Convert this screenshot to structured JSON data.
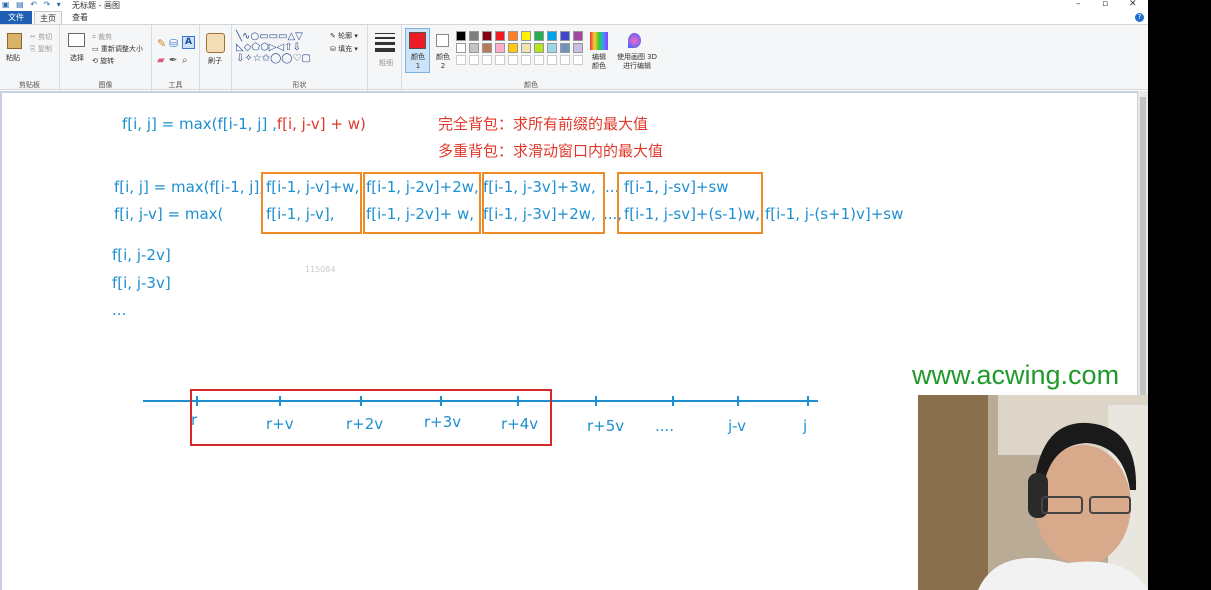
{
  "window": {
    "title": "无标题 - 画图",
    "controls": [
      "–",
      "▫",
      "✕"
    ]
  },
  "menu": {
    "file": "文件",
    "tabs": [
      "主页",
      "查看"
    ]
  },
  "ribbon": {
    "clipboard": {
      "paste": "粘贴",
      "cut": "剪切",
      "copy": "复制",
      "label": "剪贴板"
    },
    "image": {
      "select": "选择",
      "crop": "裁剪",
      "resize": "重新调整大小",
      "rotate": "旋转",
      "label": "图像"
    },
    "tools": {
      "label": "工具",
      "text": "A"
    },
    "brushes": {
      "label": "刷子"
    },
    "shapes": {
      "outline": "轮廓",
      "fill": "填充",
      "label": "形状"
    },
    "size": {
      "label": "粗细"
    },
    "colors": {
      "color1": "颜色 1",
      "color2": "颜色 2",
      "edit": "编辑颜色",
      "paint3d": "使用画图 3D 进行编辑",
      "label": "颜色",
      "palette": [
        "#000000",
        "#7f7f7f",
        "#880015",
        "#ed1c24",
        "#ff7f27",
        "#fff200",
        "#22b14c",
        "#00a2e8",
        "#3f48cc",
        "#a349a4",
        "#ffffff",
        "#c3c3c3",
        "#b97a57",
        "#ffaec9",
        "#ffc90e",
        "#efe4b0",
        "#b5e61d",
        "#99d9ea",
        "#7092be",
        "#c8bfe7"
      ],
      "active": "#ed1c24"
    }
  },
  "canvas": {
    "line1_blue": "f[i, j] = max(f[i-1, j] ,",
    "line1_red": "f[i, j-v] + w)",
    "note1": "完全背包：求所有前缀的最大值",
    "note2": "多重背包：求滑动窗口内的最大值",
    "row1_prefix": "f[i, j] = max(f[i-1, j],",
    "row1_t1": "f[i-1, j-v]+w,",
    "row1_t2": "f[i-1, j-2v]+2w,",
    "row1_t3": "f[i-1, j-3v]+3w,",
    "row1_dots": "...",
    "row1_t4": "f[i-1, j-sv]+sw",
    "row2_prefix": "f[i, j-v] = max(",
    "row2_t1": "f[i-1, j-v],",
    "row2_t2": "f[i-1, j-2v]+  w,",
    "row2_t3": "f[i-1, j-3v]+2w,",
    "row2_dots": "...,",
    "row2_t4": "f[i-1, j-sv]+(s-1)w,",
    "row2_t5": "f[i-1, j-(s+1)v]+sw",
    "list1": "f[i, j-2v]",
    "list2": "f[i, j-3v]",
    "list3": "...",
    "watermark": "115084",
    "axis_labels": [
      "r",
      "r+v",
      "r+2v",
      "r+3v",
      "r+4v",
      "r+5v",
      "....",
      "j-v",
      "j"
    ]
  },
  "overlay": {
    "brand": "www.acwing.com"
  }
}
